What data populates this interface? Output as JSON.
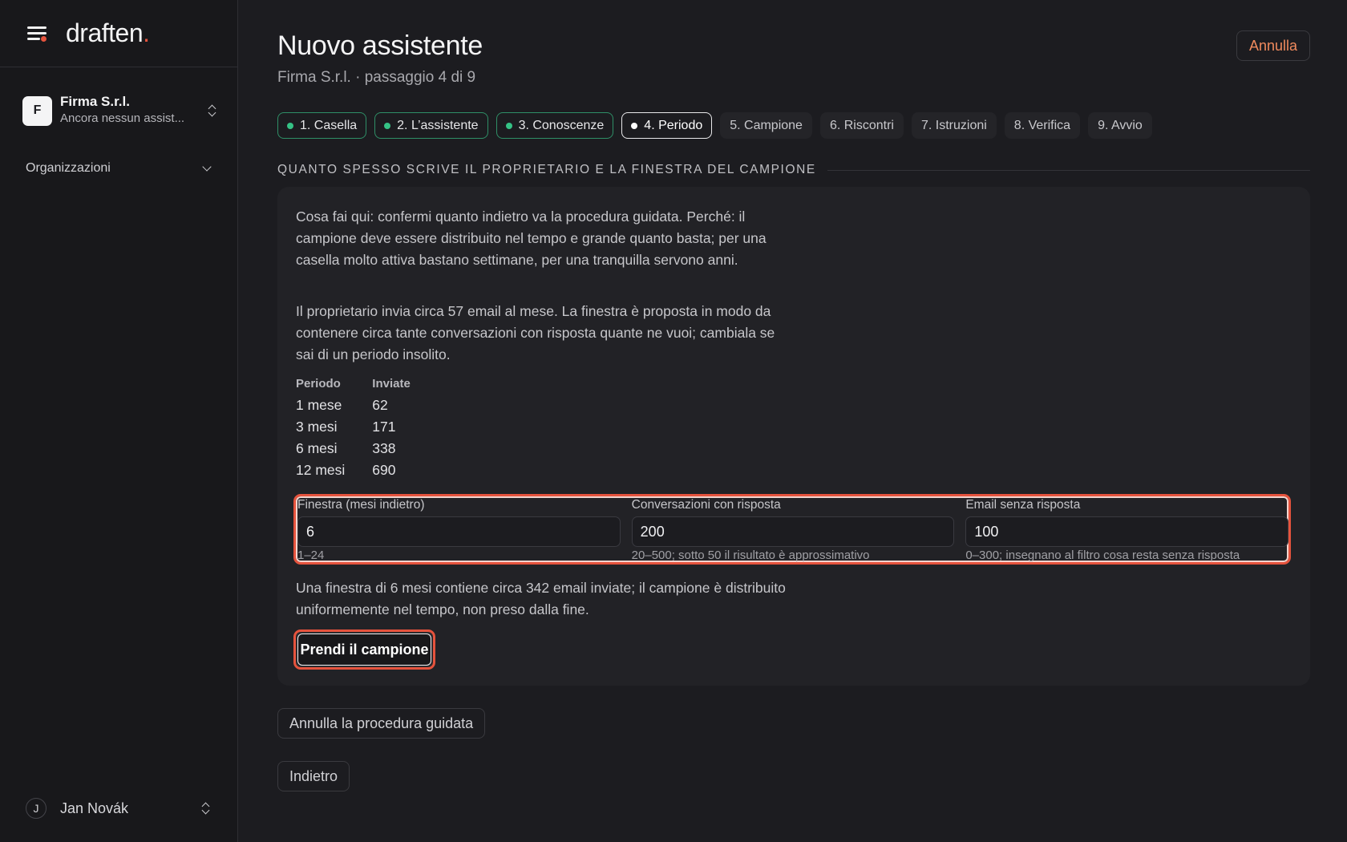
{
  "sidebar": {
    "logo": "draften",
    "logo_dot": ".",
    "org": {
      "initial": "F",
      "name": "Firma S.r.l.",
      "subtitle": "Ancora nessun assist..."
    },
    "nav_section": "Organizzazioni",
    "user": {
      "initial": "J",
      "name": "Jan Novák"
    }
  },
  "header": {
    "title": "Nuovo assistente",
    "subtitle": "Firma S.r.l. · passaggio 4 di 9",
    "cancel_label": "Annulla"
  },
  "steps": [
    {
      "label": "1. Casella",
      "state": "done"
    },
    {
      "label": "2. L’assistente",
      "state": "done"
    },
    {
      "label": "3. Conoscenze",
      "state": "done"
    },
    {
      "label": "4. Periodo",
      "state": "current"
    },
    {
      "label": "5. Campione",
      "state": "todo"
    },
    {
      "label": "6. Riscontri",
      "state": "todo"
    },
    {
      "label": "7. Istruzioni",
      "state": "todo"
    },
    {
      "label": "8. Verifica",
      "state": "todo"
    },
    {
      "label": "9. Avvio",
      "state": "todo"
    }
  ],
  "section": {
    "title": "QUANTO SPESSO SCRIVE IL PROPRIETARIO E LA FINESTRA DEL CAMPIONE",
    "intro": "Cosa fai qui: confermi quanto indietro va la procedura guidata. Perché: il campione deve essere distribuito nel tempo e grande quanto basta; per una casella molto attiva bastano settimane, per una tranquilla servono anni.",
    "rate_text": "Il proprietario invia circa 57 email al mese. La finestra è proposta in modo da contenere circa tante conversazioni con risposta quante ne vuoi; cambiala se sai di un periodo insolito.",
    "table": {
      "headers": [
        "Periodo",
        "Inviate"
      ],
      "rows": [
        [
          "1 mese",
          "62"
        ],
        [
          "3 mesi",
          "171"
        ],
        [
          "6 mesi",
          "338"
        ],
        [
          "12 mesi",
          "690"
        ]
      ]
    },
    "fields": [
      {
        "label": "Finestra (mesi indietro)",
        "value": "6",
        "hint": "1–24"
      },
      {
        "label": "Conversazioni con risposta",
        "value": "200",
        "hint": "20–500; sotto 50 il risultato è approssimativo"
      },
      {
        "label": "Email senza risposta",
        "value": "100",
        "hint": "0–300; insegnano al filtro cosa resta senza risposta"
      }
    ],
    "summary": "Una finestra di 6 mesi contiene circa 342 email inviate; il campione è distribuito uniformemente nel tempo, non preso dalla fine.",
    "primary_label": "Prendi il campione"
  },
  "footer": {
    "abort_label": "Annulla la procedura guidata",
    "back_label": "Indietro"
  },
  "colors": {
    "accent": "#e5533d",
    "done_dot": "#35c285",
    "cancel_text": "#f08a5d"
  }
}
